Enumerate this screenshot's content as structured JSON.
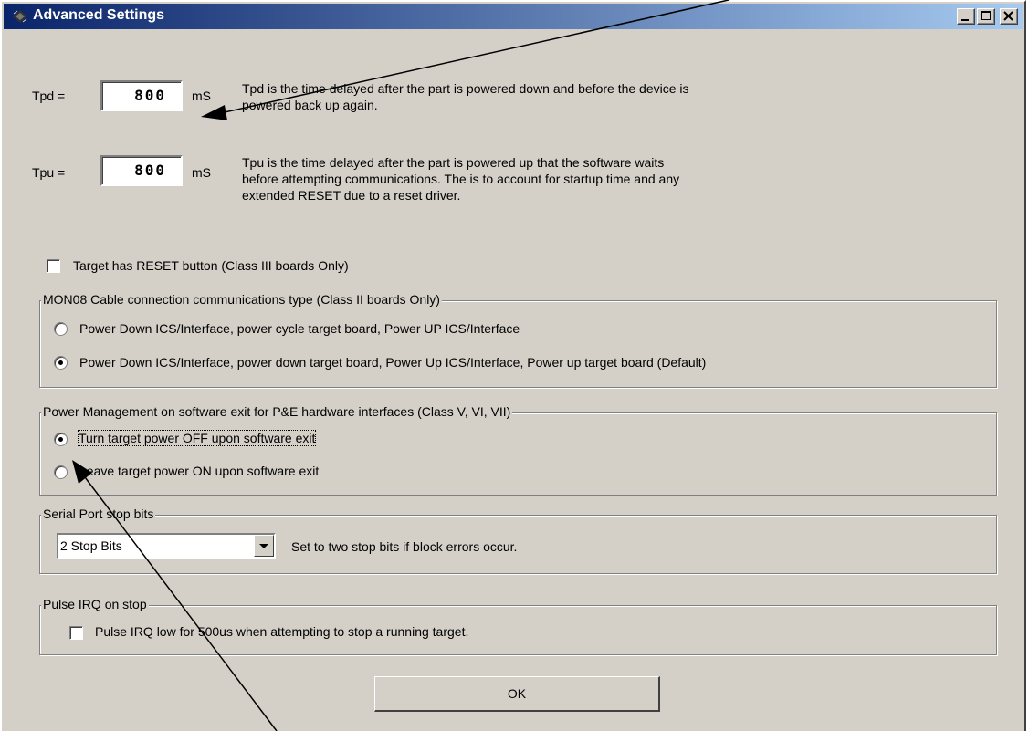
{
  "window": {
    "title": "Advanced Settings"
  },
  "tpd": {
    "label": "Tpd =",
    "value": "800",
    "unit": "mS",
    "description": "Tpd is the time delayed after the part is powered down and before the device is powered back up again."
  },
  "tpu": {
    "label": "Tpu =",
    "value": "800",
    "unit": "mS",
    "description": "Tpu is the time delayed after the part is powered up that the software waits before attempting communications. The is to account for startup time and any extended RESET due to a reset driver."
  },
  "reset_checkbox": {
    "label": "Target has RESET button (Class III boards Only)",
    "checked": false
  },
  "mon08_group": {
    "title": "MON08 Cable connection communications type (Class II boards Only)",
    "options": [
      {
        "label": "Power Down ICS/Interface, power cycle target board, Power UP ICS/Interface",
        "selected": false
      },
      {
        "label": "Power Down ICS/Interface, power down target board, Power Up ICS/Interface, Power up target board (Default)",
        "selected": true
      }
    ]
  },
  "power_group": {
    "title": "Power Management on software exit for P&E hardware interfaces (Class V, VI, VII)",
    "options": [
      {
        "label": "Turn target power OFF upon software exit",
        "selected": true
      },
      {
        "label": "Leave target power ON upon software exit",
        "selected": false
      }
    ]
  },
  "serial_group": {
    "title": "Serial Port stop bits",
    "selected": "2 Stop Bits",
    "hint": "Set to two stop bits if block errors occur."
  },
  "pulse_group": {
    "title": "Pulse IRQ on stop",
    "checkbox_label": "Pulse IRQ low for 500us when attempting to stop a running target.",
    "checked": false
  },
  "ok_button": {
    "label": "OK"
  },
  "colors": {
    "title_start": "#0a246a",
    "title_end": "#a6caf0",
    "face": "#d4d0c8"
  }
}
